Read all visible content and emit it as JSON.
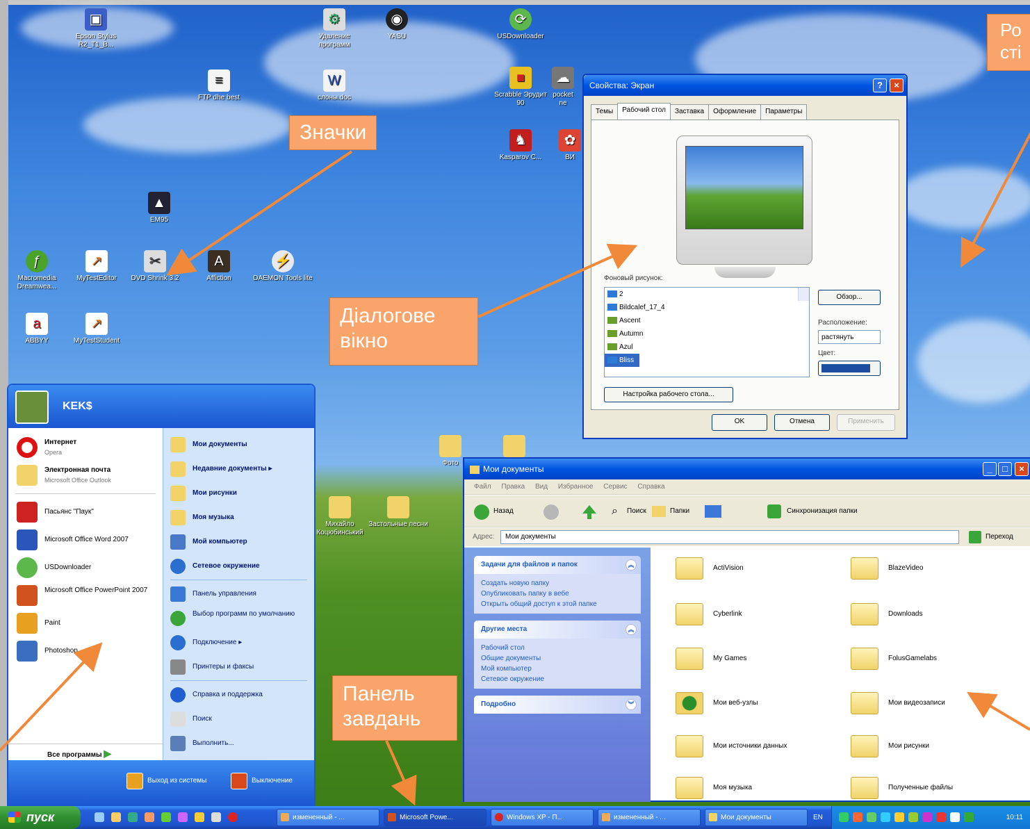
{
  "callouts": {
    "icons": "Значки",
    "dialog_line1": "Діалогове",
    "dialog_line2": "вікно",
    "wallpaper_line1": "Ро",
    "wallpaper_line2": "сті",
    "taskbar_line1": "Панель",
    "taskbar_line2": "завдань"
  },
  "desktop_icons": [
    {
      "label": "Epson Stylus R2_T1_B...",
      "name": "epson-icon"
    },
    {
      "label": "Удаление программ",
      "name": "uninstall-icon"
    },
    {
      "label": "YASU",
      "name": "yasu-icon"
    },
    {
      "label": "USDownloader",
      "name": "usdownloader-icon"
    },
    {
      "label": "FTP dhe best",
      "name": "ftp-icon"
    },
    {
      "label": "слоны.doc",
      "name": "word-doc-icon"
    },
    {
      "label": "Scrabble Эрудит 90",
      "name": "scrabble-icon"
    },
    {
      "label": "pocket ne",
      "name": "pocket-icon"
    },
    {
      "label": "Kasparov C...",
      "name": "kasparov-icon"
    },
    {
      "label": "ВИ",
      "name": "vi-icon"
    },
    {
      "label": "EM95",
      "name": "em95-icon"
    },
    {
      "label": "Macromedia Dreamwea...",
      "name": "dreamweaver-icon"
    },
    {
      "label": "MyTestEditor",
      "name": "mytesteditor-icon"
    },
    {
      "label": "DVD Shrink 3.2",
      "name": "dvdshrink-icon"
    },
    {
      "label": "Affiction",
      "name": "affiction-icon"
    },
    {
      "label": "DAEMON Tools lite",
      "name": "daemon-icon"
    },
    {
      "label": "ABBYY",
      "name": "abbyy-icon"
    },
    {
      "label": "MyTestStudent",
      "name": "myteststudent-icon"
    },
    {
      "label": "Михайло Коцюбинський",
      "name": "folder-mykhailo-icon"
    },
    {
      "label": "Застольные песни",
      "name": "folder-songs-icon"
    },
    {
      "label": "Фото",
      "name": "folder-photo-icon"
    }
  ],
  "dialog": {
    "title": "Свойства: Экран",
    "help": "?",
    "close": "×",
    "tabs": [
      "Темы",
      "Рабочий стол",
      "Заставка",
      "Оформление",
      "Параметры"
    ],
    "bg_label": "Фоновый рисунок:",
    "bg_items": [
      "2",
      "Bildcalef_17_4",
      "Ascent",
      "Autumn",
      "Azul",
      "Bliss"
    ],
    "browse": "Обзор...",
    "position_label": "Расположение:",
    "position_value": "растянуть",
    "color_label": "Цвет:",
    "customize": "Настройка рабочего стола...",
    "ok": "OK",
    "cancel": "Отмена",
    "apply": "Применить"
  },
  "explorer": {
    "title": "Мои документы",
    "menu": [
      "Файл",
      "Правка",
      "Вид",
      "Избранное",
      "Сервис",
      "Справка"
    ],
    "back": "Назад",
    "search": "Поиск",
    "folders": "Папки",
    "sync": "Синхронизация папки",
    "address_label": "Адрес:",
    "address_value": "Мои документы",
    "go": "Переход",
    "task_title": "Задачи для файлов и папок",
    "tasks": [
      "Создать новую папку",
      "Опубликовать папку в вебе",
      "Открыть общий доступ к этой папке"
    ],
    "places_title": "Другие места",
    "places": [
      "Рабочий стол",
      "Общие документы",
      "Мой компьютер",
      "Сетевое окружение"
    ],
    "details_title": "Подробно",
    "files": [
      "ActiVision",
      "BlazeVideo",
      "Cyberlink",
      "Downloads",
      "My Games",
      "FolusGamelabs",
      "Мои веб-узлы",
      "Мои видеозаписи",
      "Мои источники данных",
      "Мои рисунки",
      "Моя музыка",
      "Полученные файлы"
    ]
  },
  "start_menu": {
    "user": "KEK$",
    "pinned": [
      {
        "title": "Интернет",
        "sub": "Opera"
      },
      {
        "title": "Электронная почта",
        "sub": "Microsoft Office Outlook"
      }
    ],
    "recent": [
      "Пасьянс \"Паук\"",
      "Microsoft Office Word 2007",
      "USDownloader",
      "Microsoft Office PowerPoint 2007",
      "Paint",
      "Photoshop"
    ],
    "all_programs": "Все программы",
    "right": [
      "Мои документы",
      "Недавние документы",
      "Мои рисунки",
      "Моя музыка",
      "Мой компьютер",
      "Сетевое окружение",
      "Панель управления",
      "Выбор программ по умолчанию",
      "Подключение",
      "Принтеры и факсы",
      "Справка и поддержка",
      "Поиск",
      "Выполнить..."
    ],
    "logoff": "Выход из системы",
    "shutdown": "Выключение"
  },
  "taskbar": {
    "start": "пуск",
    "tasks": [
      "измененный - ...",
      "Microsoft Powe...",
      "Windows XP - П...",
      "измененный - ...",
      "Мои документы"
    ],
    "lang": "EN",
    "clock": "10:11"
  }
}
